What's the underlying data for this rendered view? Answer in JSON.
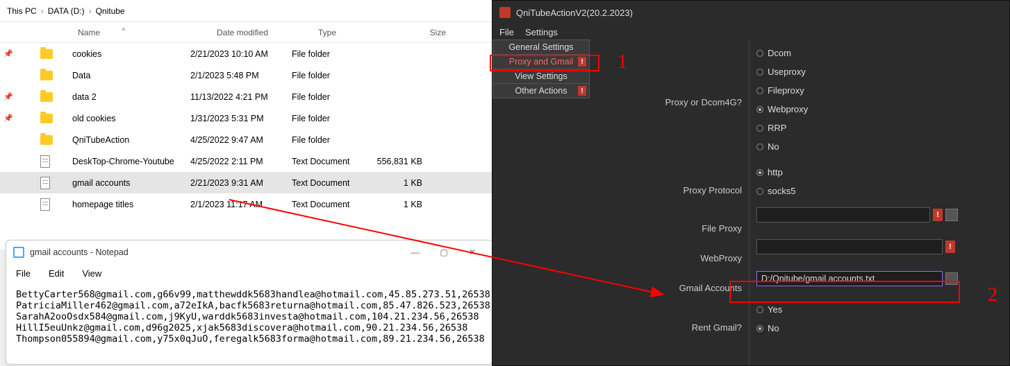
{
  "explorer": {
    "breadcrumb": [
      "This PC",
      "DATA (D:)",
      "Qnitube"
    ],
    "headers": {
      "name": "Name",
      "date": "Date modified",
      "type": "Type",
      "size": "Size"
    },
    "rows": [
      {
        "pin": true,
        "icon": "folder",
        "name": "cookies",
        "date": "2/21/2023 10:10 AM",
        "type": "File folder",
        "size": ""
      },
      {
        "pin": false,
        "icon": "folder",
        "name": "Data",
        "date": "2/1/2023 5:48 PM",
        "type": "File folder",
        "size": ""
      },
      {
        "pin": true,
        "icon": "folder",
        "name": "data 2",
        "date": "11/13/2022 4:21 PM",
        "type": "File folder",
        "size": ""
      },
      {
        "pin": true,
        "icon": "folder",
        "name": "old cookies",
        "date": "1/31/2023 5:31 PM",
        "type": "File folder",
        "size": ""
      },
      {
        "pin": false,
        "icon": "folder",
        "name": "QniTubeAction",
        "date": "4/25/2022 9:47 AM",
        "type": "File folder",
        "size": ""
      },
      {
        "pin": false,
        "icon": "doc",
        "name": "DeskTop-Chrome-Youtube",
        "date": "4/25/2022 2:11 PM",
        "type": "Text Document",
        "size": "556,831 KB"
      },
      {
        "pin": false,
        "icon": "doc",
        "name": "gmail accounts",
        "date": "2/21/2023 9:31 AM",
        "type": "Text Document",
        "size": "1 KB",
        "selected": true
      },
      {
        "pin": false,
        "icon": "doc",
        "name": "homepage titles",
        "date": "2/1/2023 11:17 AM",
        "type": "Text Document",
        "size": "1 KB"
      }
    ]
  },
  "notepad": {
    "title": "gmail accounts - Notepad",
    "menu": [
      "File",
      "Edit",
      "View"
    ],
    "lines": [
      "BettyCarter568@gmail.com,g66v99,matthewddk5683handlea@hotmail.com,45.85.273.51,26538",
      "PatriciaMiller462@gmail.com,a72eIkA,bacfk5683returna@hotmail.com,85.47.826.523,26538",
      "SarahA2ooOsdx584@gmail.com,j9KyU,warddk5683investa@hotmail.com,104.21.234.56,26538",
      "HillI5euUnkz@gmail.com,d96g2025,xjak5683discovera@hotmail.com,90.21.234.56,26538",
      "Thompson055894@gmail.com,y75x0qJuO,feregalk5683forma@hotmail.com,89.21.234.56,26538"
    ]
  },
  "app": {
    "title": "QniTubeActionV2(20.2.2023)",
    "menu": [
      "File",
      "Settings"
    ],
    "tabs": [
      "General Settings",
      "Proxy and Gmail",
      "View Settings",
      "Other Actions"
    ],
    "tab_alerts": [
      false,
      true,
      false,
      true
    ],
    "tab_selected": 1,
    "leftLabels": {
      "proxyOrDcom": "Proxy or Dcom4G?",
      "proxyProtocol": "Proxy Protocol",
      "fileProxy": "File Proxy",
      "webProxy": "WebProxy",
      "gmailAccounts": "Gmail Accounts",
      "rentGmail": "Rent Gmail?"
    },
    "annotations": {
      "n1": "1",
      "n2": "2"
    },
    "proxyOrDcom": {
      "options": [
        "Dcom",
        "Useproxy",
        "Fileproxy",
        "Webproxy",
        "RRP",
        "No"
      ],
      "selected": "Webproxy"
    },
    "proxyProtocol": {
      "options": [
        "http",
        "socks5"
      ],
      "selected": "http"
    },
    "fileProxy": "",
    "webProxy": "",
    "gmailAccountsPath": "D:/Qnitube/gmail accounts.txt",
    "rentGmail": {
      "options": [
        "Yes",
        "No"
      ],
      "selected": "No"
    }
  }
}
